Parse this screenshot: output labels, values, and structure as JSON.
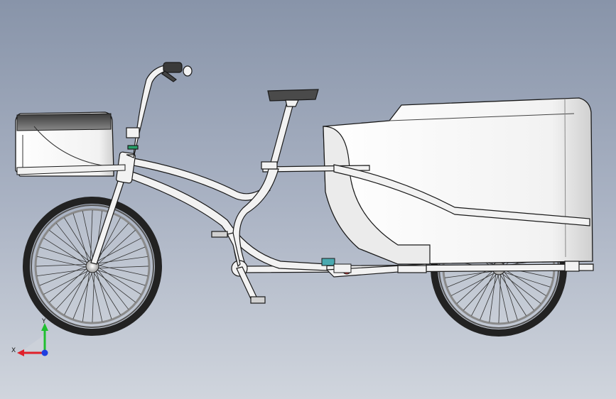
{
  "viewport": {
    "background_top": "#8894a9",
    "background_bottom": "#d0d5dd",
    "model": {
      "description_icon": "cargo-tricycle-3d-model",
      "part_color": "#f2f2f2",
      "edge_color": "#1a1a1a",
      "tire_color": "#222222"
    },
    "triad": {
      "x_label": "X",
      "y_label": "Y",
      "x_color": "#e0202a",
      "y_color": "#1fbf2f",
      "z_color": "#1f3fe0"
    }
  }
}
